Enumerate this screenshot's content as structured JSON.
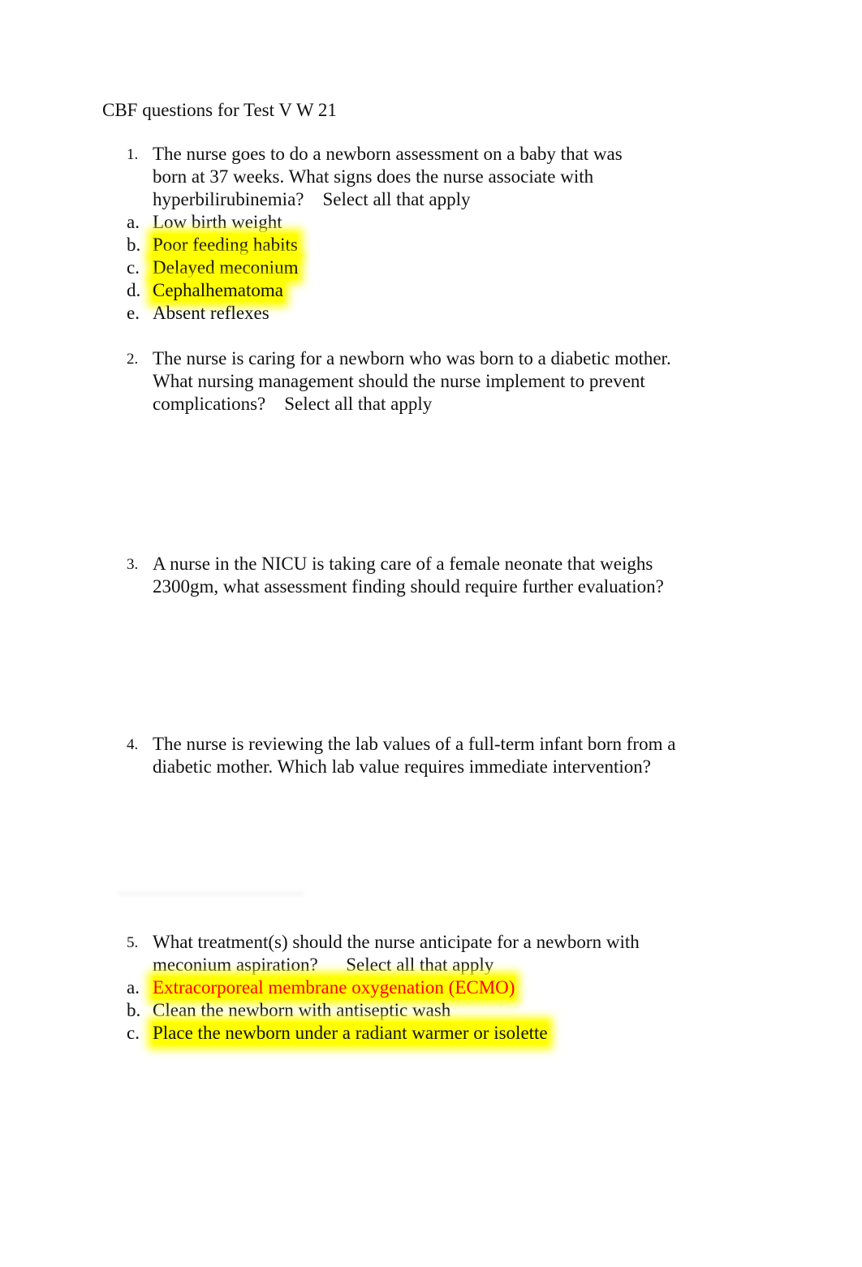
{
  "document": {
    "title": "CBF questions for Test V W 21",
    "questions": [
      {
        "number": "1.",
        "lines": [
          "The nurse goes to do a newborn assessment on a baby that was",
          "born at 37 weeks. What signs does the nurse associate with",
          "hyperbilirubinemia?    Select all that apply"
        ],
        "options": [
          {
            "letter": "a.",
            "text": "Low birth weight",
            "highlighted": false
          },
          {
            "letter": "b.",
            "text": "Poor feeding habits",
            "highlighted": true
          },
          {
            "letter": "c.",
            "text": "Delayed meconium",
            "highlighted": true
          },
          {
            "letter": "d.",
            "text": "Cephalhematoma",
            "highlighted": true
          },
          {
            "letter": "e.",
            "text": "Absent reflexes",
            "highlighted": false
          }
        ]
      },
      {
        "number": "2.",
        "lines": [
          "The nurse is caring for a newborn who was born to a diabetic mother.",
          "What nursing management should the nurse implement to prevent",
          "complications?    Select all that apply"
        ],
        "options": []
      },
      {
        "number": "3.",
        "lines": [
          "A nurse in the NICU is taking care of a female neonate that weighs",
          "2300gm, what assessment finding should require further evaluation?"
        ],
        "options": []
      },
      {
        "number": "4.",
        "lines": [
          "The nurse is reviewing the lab values of a full-term infant born from a",
          "diabetic mother. Which lab value requires immediate intervention?"
        ],
        "options": []
      },
      {
        "number": "5.",
        "lines": [
          "What treatment(s) should the nurse anticipate for a newborn with",
          "meconium aspiration?      Select all that apply"
        ],
        "options": [
          {
            "letter": "a.",
            "text": "Extracorporeal membrane oxygenation (ECMO)",
            "highlighted": true,
            "color": "#ff0000"
          },
          {
            "letter": "b.",
            "text": "Clean the newborn with antiseptic wash",
            "highlighted": false
          },
          {
            "letter": "c.",
            "text": "Place the newborn under a radiant warmer or isolette",
            "highlighted": true
          }
        ]
      }
    ],
    "colors": {
      "highlight": "#ffff00",
      "answer_red": "#ff0000",
      "text": "#111111"
    }
  }
}
